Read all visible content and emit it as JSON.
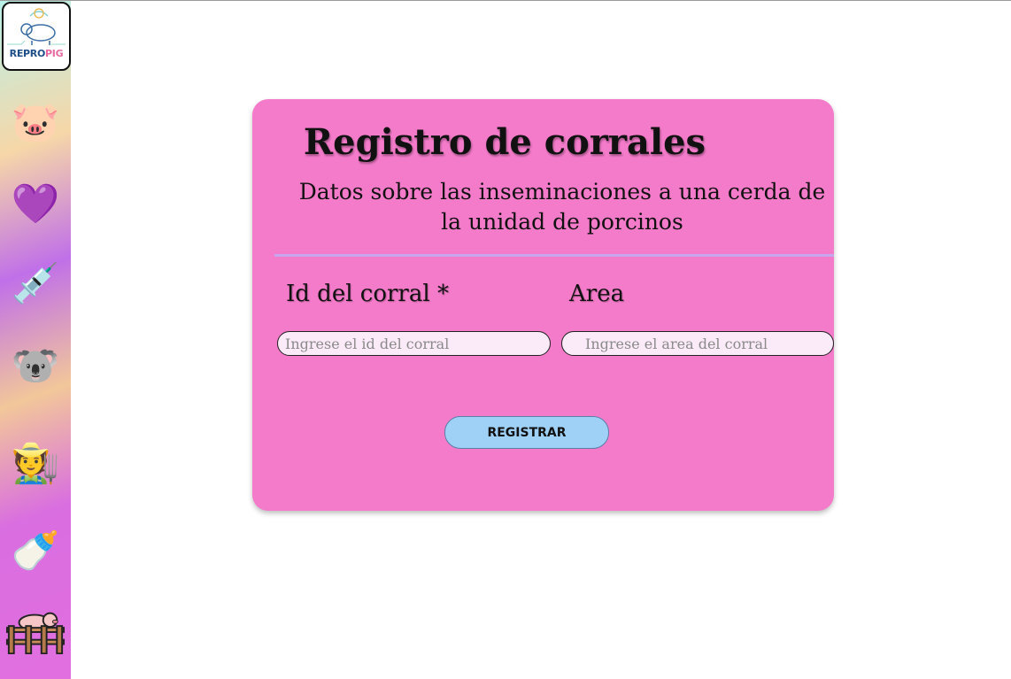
{
  "sidebar": {
    "logo": {
      "text_a": "REPRO",
      "text_b": "PIG"
    },
    "items": [
      {
        "name": "pig-face-icon",
        "glyph": "🐷"
      },
      {
        "name": "purple-heart-icon",
        "glyph": "💜"
      },
      {
        "name": "syringe-icon",
        "glyph": "💉"
      },
      {
        "name": "koala-icon",
        "glyph": "🐨"
      },
      {
        "name": "farmer-icon",
        "glyph": "🧑‍🌾"
      },
      {
        "name": "baby-bottle-icon",
        "glyph": "🍼"
      },
      {
        "name": "pig-pen-icon",
        "glyph": "🐖"
      }
    ]
  },
  "form": {
    "title": "Registro de corrales",
    "subtitle": "Datos sobre las inseminaciones a una cerda de la unidad de porcinos",
    "fields": {
      "id": {
        "label": "Id del corral *",
        "placeholder": "Ingrese el id del corral",
        "value": ""
      },
      "area": {
        "label": "Area",
        "placeholder": "Ingrese el area del corral",
        "value": ""
      }
    },
    "submit_label": "REGISTRAR"
  },
  "colors": {
    "card_background": "#f47bca",
    "button_background": "#9fd0f5",
    "divider": "#c7a6ee",
    "input_background": "#fbeaf7"
  }
}
